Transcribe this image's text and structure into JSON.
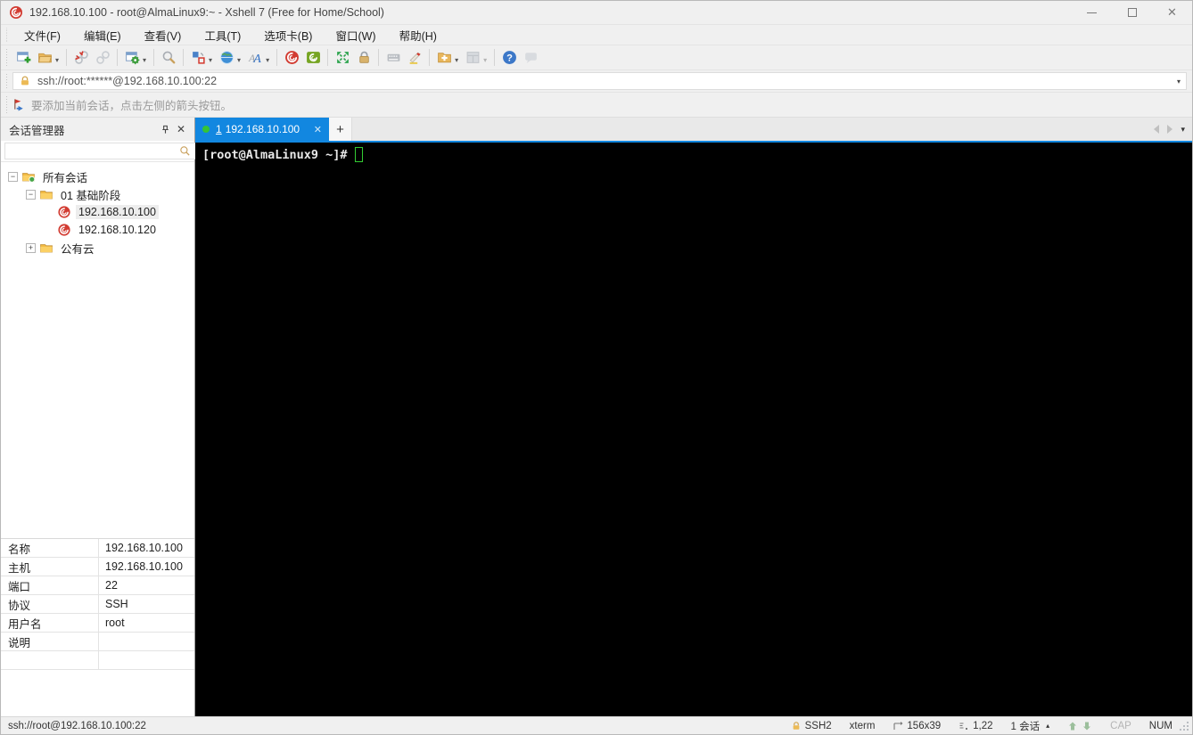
{
  "window": {
    "title": "192.168.10.100 - root@AlmaLinux9:~ - Xshell 7 (Free for Home/School)"
  },
  "menubar": {
    "items": [
      {
        "label": "文件(F)"
      },
      {
        "label": "编辑(E)"
      },
      {
        "label": "查看(V)"
      },
      {
        "label": "工具(T)"
      },
      {
        "label": "选项卡(B)"
      },
      {
        "label": "窗口(W)"
      },
      {
        "label": "帮助(H)"
      }
    ]
  },
  "toolbar": {
    "buttons": [
      "new-session",
      "open",
      "disconnect",
      "reconnect",
      "session-properties",
      "find",
      "compose",
      "web-browser",
      "font",
      "xshell",
      "xftp",
      "fullscreen",
      "lock",
      "virtual-keyboard",
      "highlight",
      "new-folder",
      "tile-windows",
      "help",
      "message"
    ]
  },
  "addressbar": {
    "value": "ssh://root:******@192.168.10.100:22"
  },
  "noticebar": {
    "text": "要添加当前会话，点击左侧的箭头按钮。"
  },
  "session_manager": {
    "title": "会话管理器",
    "search_value": "",
    "tree": [
      {
        "label": "所有会话",
        "expander": "−",
        "icon": "all-sessions-folder"
      },
      {
        "label": "01 基础阶段",
        "expander": "−",
        "icon": "folder"
      },
      {
        "label": "192.168.10.100",
        "expander": "",
        "icon": "session",
        "selected": true
      },
      {
        "label": "192.168.10.120",
        "expander": "",
        "icon": "session"
      },
      {
        "label": "公有云",
        "expander": "+",
        "icon": "folder"
      }
    ],
    "properties": [
      {
        "label": "名称",
        "value": "192.168.10.100"
      },
      {
        "label": "主机",
        "value": "192.168.10.100"
      },
      {
        "label": "端口",
        "value": "22"
      },
      {
        "label": "协议",
        "value": "SSH"
      },
      {
        "label": "用户名",
        "value": "root"
      },
      {
        "label": "说明",
        "value": ""
      }
    ]
  },
  "tabs": {
    "active": {
      "number": "1",
      "label": "192.168.10.100",
      "close": "✕"
    },
    "new_tab": "+"
  },
  "terminal": {
    "prompt": "[root@AlmaLinux9 ~]#"
  },
  "statusbar": {
    "left": "ssh://root@192.168.10.100:22",
    "protocol": "SSH2",
    "term_type": "xterm",
    "size": "156x39",
    "cursor_pos": "1,22",
    "sessions": "1 会话",
    "cap": "CAP",
    "num": "NUM"
  },
  "icons": {
    "dropdown_arrow": "▾",
    "session_menu_arrow": "▴",
    "close": "✕",
    "pin": "pin"
  },
  "colors": {
    "active_tab": "#1287e0",
    "terminal_background": "#000000",
    "terminal_text": "#e8e8e8",
    "terminal_cursor": "#33cc33",
    "xshell_red": "#d23c32",
    "xftp_green": "#76a523",
    "folder_yellow": "#f0b73e",
    "lock_orange": "#ecba55",
    "chrome_gray": "#f0f0f0"
  }
}
